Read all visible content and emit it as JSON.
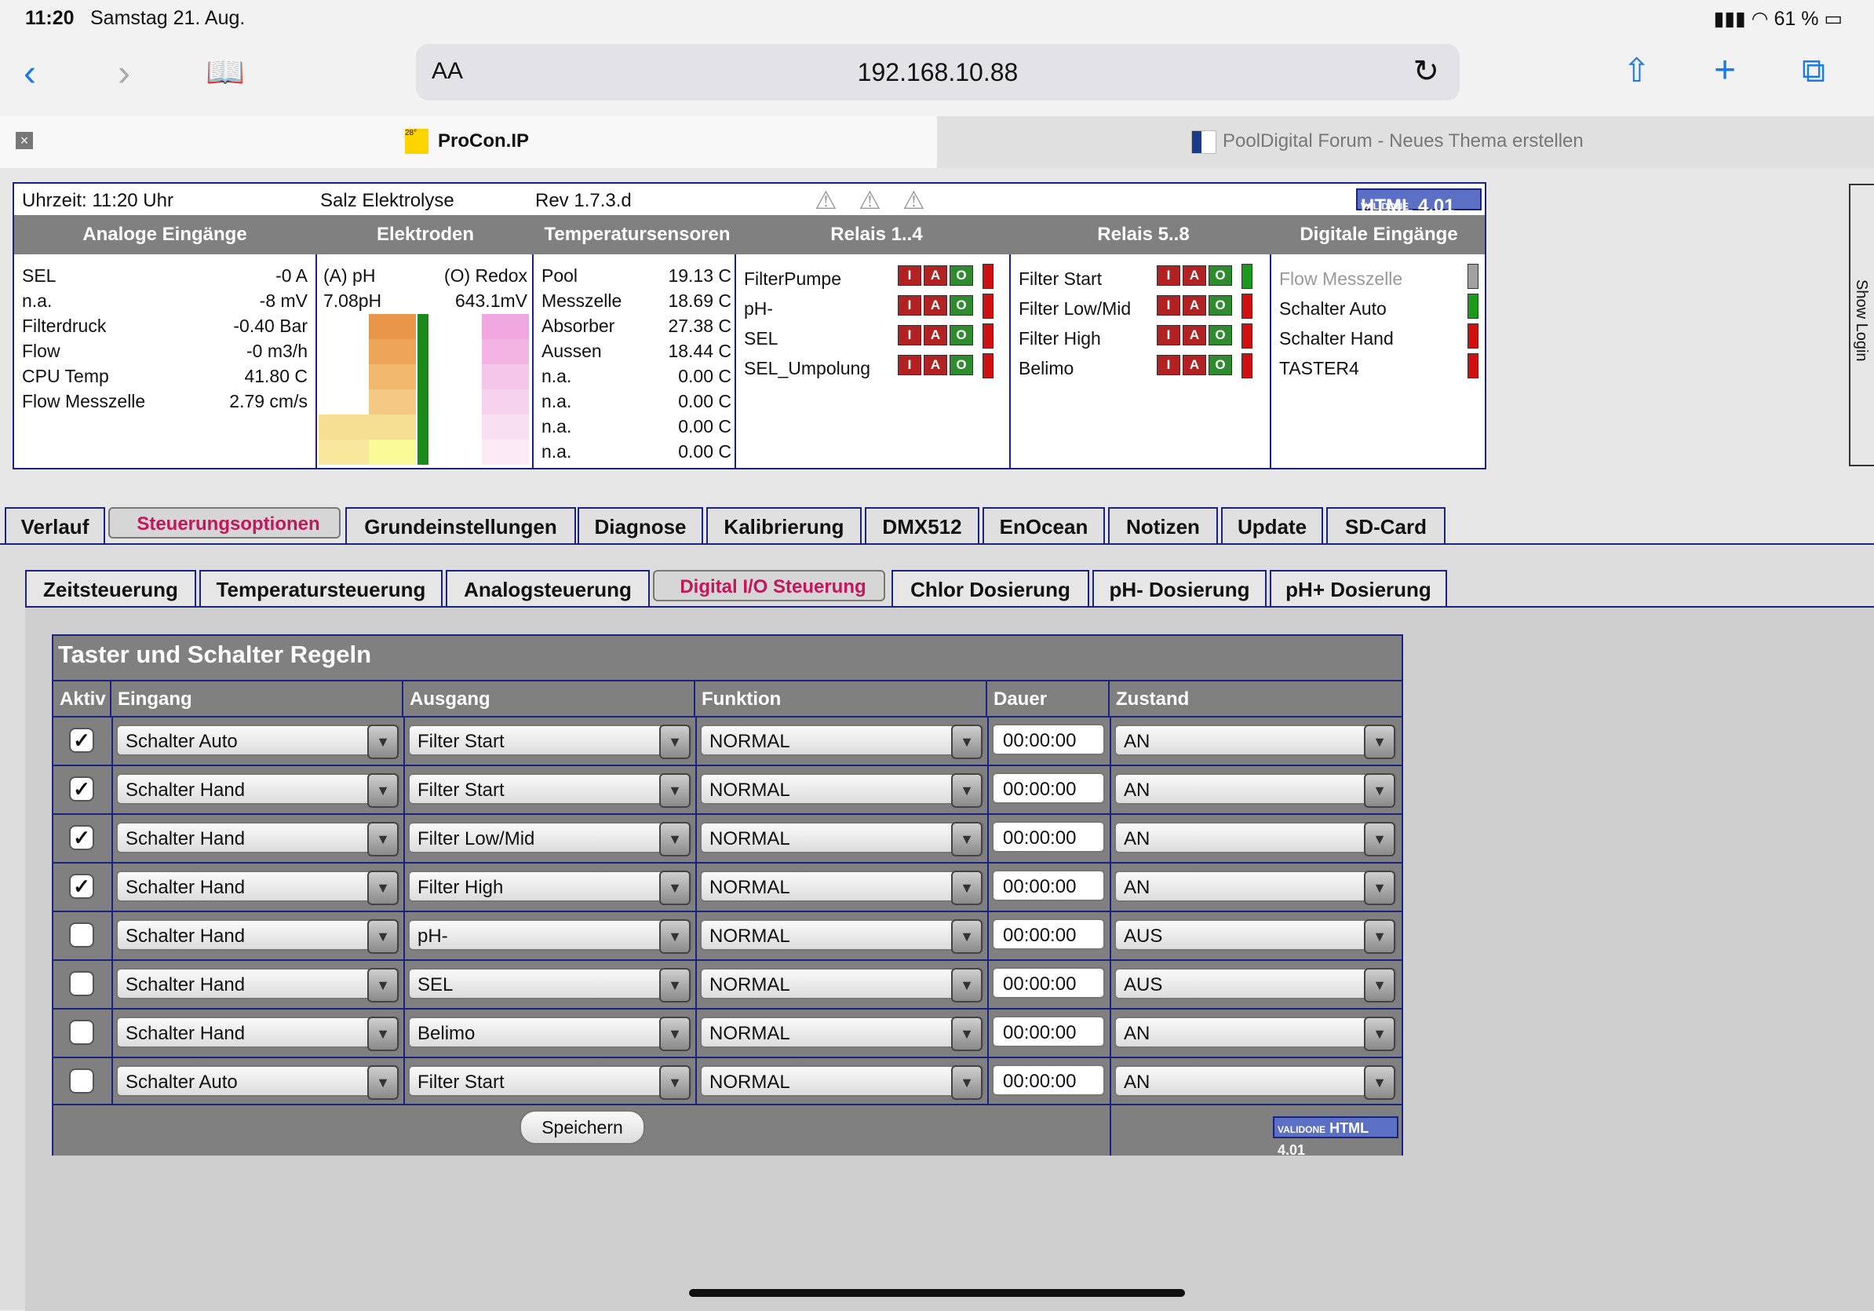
{
  "status_bar": {
    "time": "11:20",
    "date": "Samstag 21. Aug.",
    "battery": "61 %"
  },
  "browser": {
    "address_text_size": "AA",
    "address": "192.168.10.88",
    "tabs": [
      {
        "title": "ProCon.IP",
        "favicon_text": "28°"
      },
      {
        "title": "PoolDigital Forum - Neues Thema erstellen"
      }
    ]
  },
  "header_row": {
    "time": "Uhrzeit: 11:20 Uhr",
    "mode": "Salz Elektrolyse",
    "rev": "Rev 1.7.3.d",
    "badge": "HTML 4.01",
    "badge_logo": "VALIDONE"
  },
  "columns": [
    "Analoge Eingänge",
    "Elektroden",
    "Temperatursensoren",
    "Relais 1..4",
    "Relais 5..8",
    "Digitale Eingänge"
  ],
  "analog": [
    {
      "label": "SEL",
      "value": "-0 A"
    },
    {
      "label": "n.a.",
      "value": "-8 mV"
    },
    {
      "label": "Filterdruck",
      "value": "-0.40 Bar"
    },
    {
      "label": "Flow",
      "value": "-0 m3/h"
    },
    {
      "label": "CPU Temp",
      "value": "41.80 C"
    },
    {
      "label": "Flow Messzelle",
      "value": "2.79 cm/s"
    }
  ],
  "electrodes": {
    "ph_label": "(A) pH",
    "redox_label": "(O) Redox",
    "ph_value": "7.08pH",
    "redox_value": "643.1mV"
  },
  "temps": [
    {
      "label": "Pool",
      "value": "19.13 C"
    },
    {
      "label": "Messzelle",
      "value": "18.69 C"
    },
    {
      "label": "Absorber",
      "value": "27.38 C"
    },
    {
      "label": "Aussen",
      "value": "18.44 C"
    },
    {
      "label": "n.a.",
      "value": "0.00 C"
    },
    {
      "label": "n.a.",
      "value": "0.00 C"
    },
    {
      "label": "n.a.",
      "value": "0.00 C"
    },
    {
      "label": "n.a.",
      "value": "0.00 C"
    }
  ],
  "iao_labels": [
    "I",
    "A",
    "O"
  ],
  "relais1": [
    "FilterPumpe",
    "pH-",
    "SEL",
    "SEL_Umpolung"
  ],
  "relais2": [
    "Filter Start",
    "Filter Low/Mid",
    "Filter High",
    "Belimo"
  ],
  "digital_inputs": [
    {
      "label": "Flow Messzelle",
      "state": "grey"
    },
    {
      "label": "Schalter Auto",
      "state": "green"
    },
    {
      "label": "Schalter Hand",
      "state": "red"
    },
    {
      "label": "TASTER4",
      "state": "red"
    }
  ],
  "main_tabs": [
    "Verlauf",
    "Steuerungsoptionen",
    "Grundeinstellungen",
    "Diagnose",
    "Kalibrierung",
    "DMX512",
    "EnOcean",
    "Notizen",
    "Update",
    "SD-Card"
  ],
  "sub_tabs": [
    "Zeitsteuerung",
    "Temperatursteuerung",
    "Analogsteuerung",
    "Digital I/O Steuerung",
    "Chlor Dosierung",
    "pH- Dosierung",
    "pH+ Dosierung"
  ],
  "rules": {
    "title": "Taster und Schalter Regeln",
    "headers": [
      "Aktiv",
      "Eingang",
      "Ausgang",
      "Funktion",
      "Dauer",
      "Zustand"
    ],
    "rows": [
      {
        "checked": true,
        "input": "Schalter Auto",
        "output": "Filter Start",
        "function": "NORMAL",
        "duration": "00:00:00",
        "state": "AN"
      },
      {
        "checked": true,
        "input": "Schalter Hand",
        "output": "Filter Start",
        "function": "NORMAL",
        "duration": "00:00:00",
        "state": "AN"
      },
      {
        "checked": true,
        "input": "Schalter Hand",
        "output": "Filter Low/Mid",
        "function": "NORMAL",
        "duration": "00:00:00",
        "state": "AN"
      },
      {
        "checked": true,
        "input": "Schalter Hand",
        "output": "Filter High",
        "function": "NORMAL",
        "duration": "00:00:00",
        "state": "AN"
      },
      {
        "checked": false,
        "input": "Schalter Hand",
        "output": "pH-",
        "function": "NORMAL",
        "duration": "00:00:00",
        "state": "AUS"
      },
      {
        "checked": false,
        "input": "Schalter Hand",
        "output": "SEL",
        "function": "NORMAL",
        "duration": "00:00:00",
        "state": "AUS"
      },
      {
        "checked": false,
        "input": "Schalter Hand",
        "output": "Belimo",
        "function": "NORMAL",
        "duration": "00:00:00",
        "state": "AN"
      },
      {
        "checked": false,
        "input": "Schalter Auto",
        "output": "Filter Start",
        "function": "NORMAL",
        "duration": "00:00:00",
        "state": "AN"
      }
    ],
    "save_label": "Speichern",
    "badge": "HTML 4.01",
    "badge_logo": "VALIDONE"
  },
  "side_login": "Show Login",
  "colors": {
    "accent": "#c2185b",
    "header": "#808080",
    "border": "#1a237e",
    "on": "#2e8b2e",
    "off": "#b22222"
  }
}
